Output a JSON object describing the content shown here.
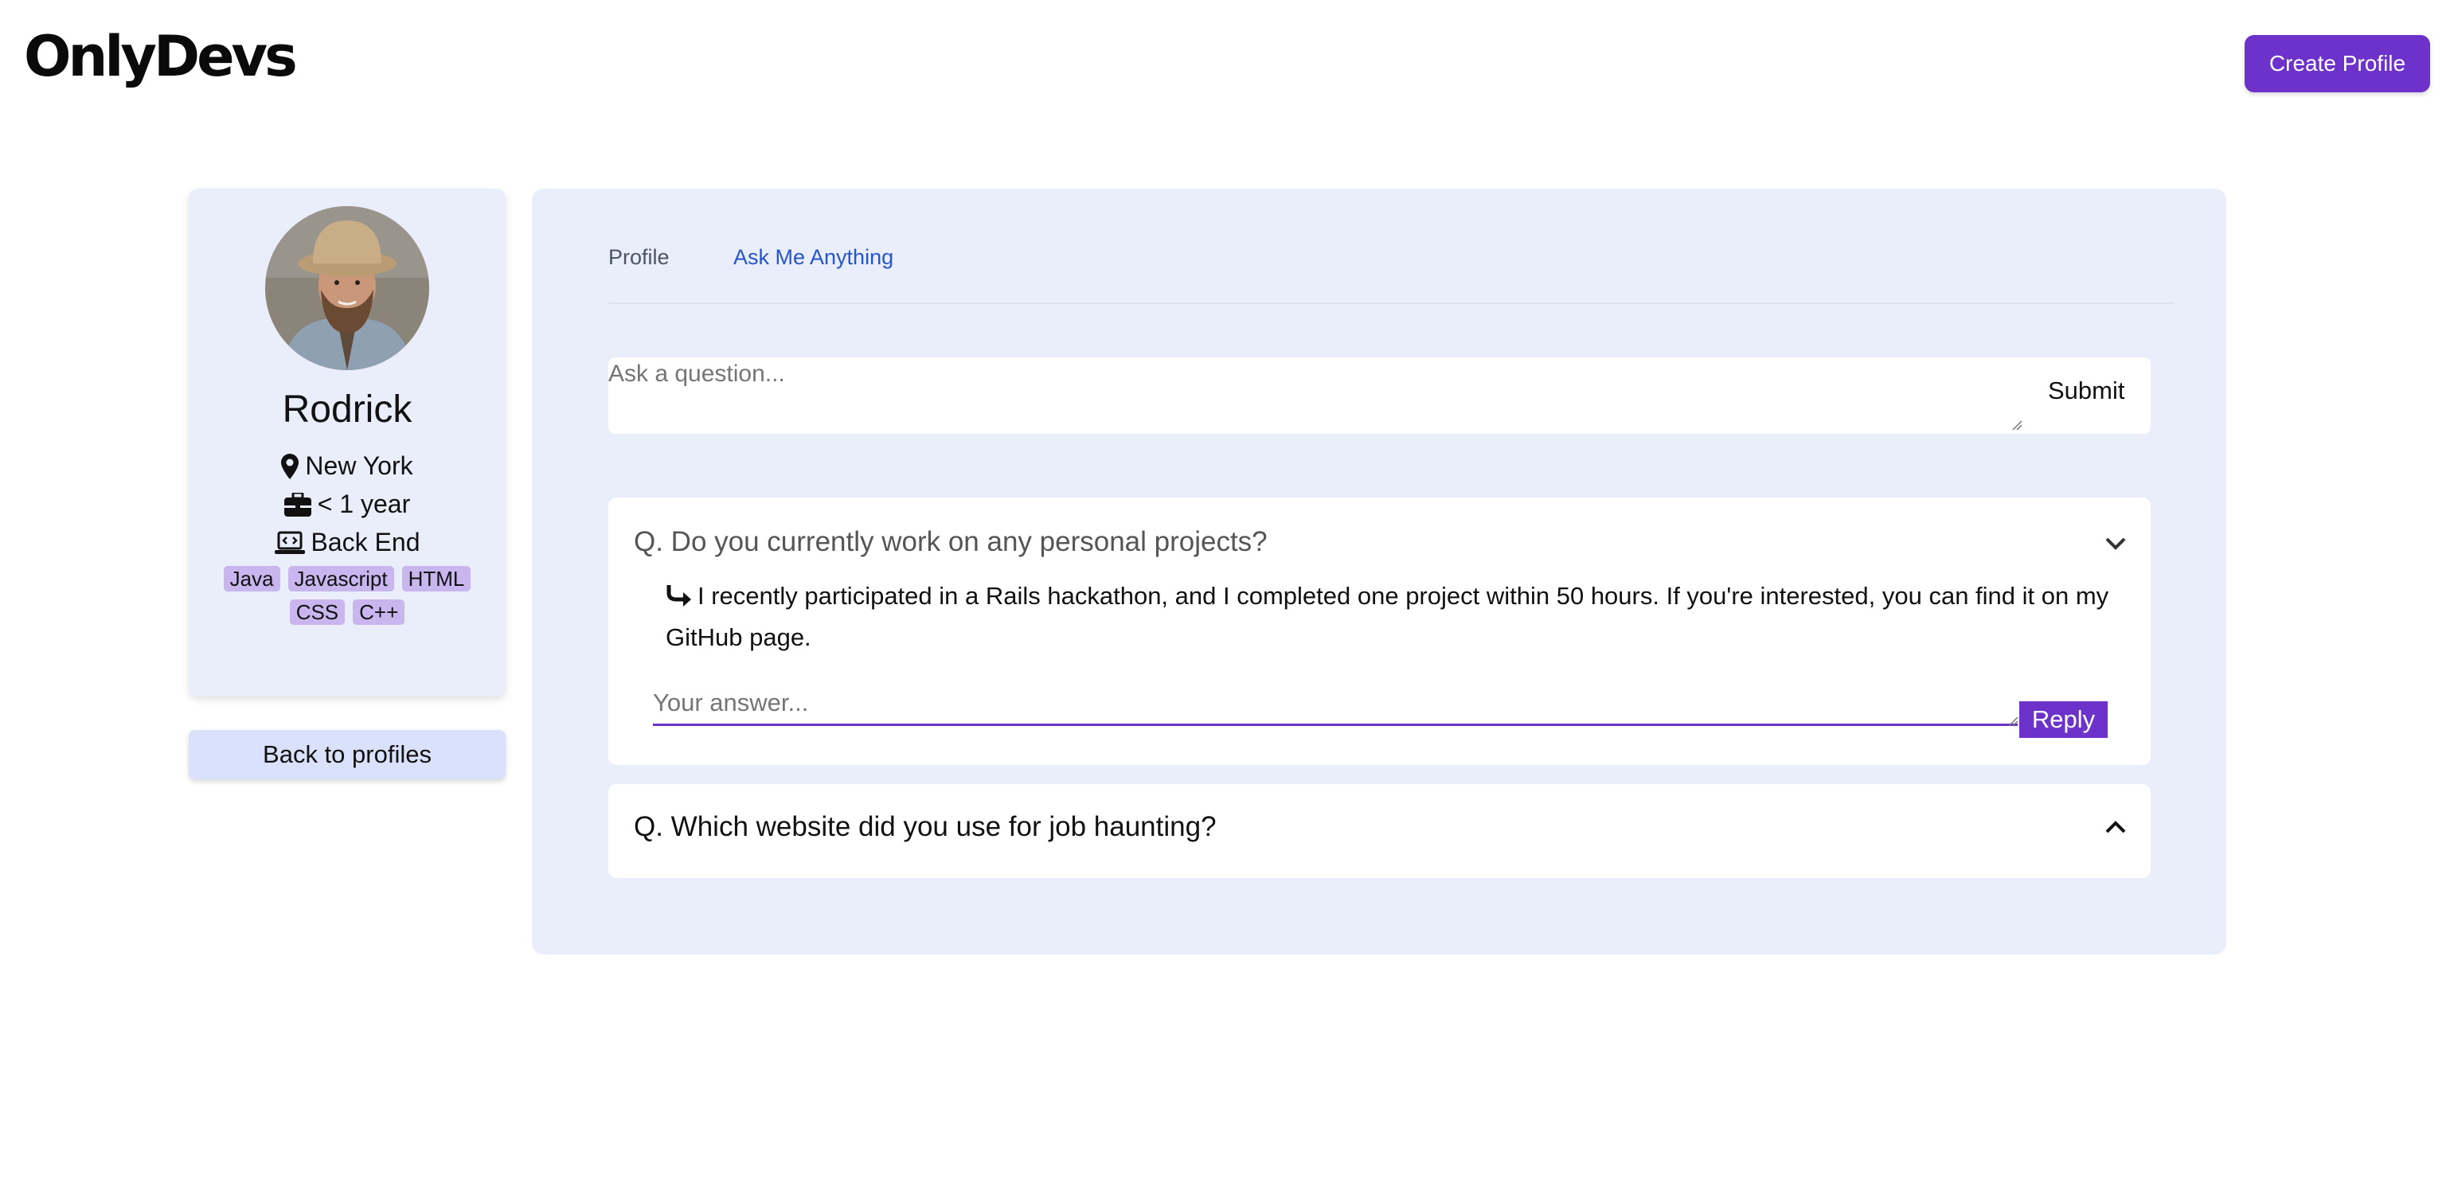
{
  "header": {
    "logo": "OnlyDevs",
    "create_profile_label": "Create Profile"
  },
  "profile": {
    "name": "Rodrick",
    "location": "New York",
    "experience": "< 1 year",
    "role": "Back End",
    "skills": [
      "Java",
      "Javascript",
      "HTML",
      "CSS",
      "C++"
    ]
  },
  "back_label": "Back to profiles",
  "tabs": [
    {
      "label": "Profile",
      "active": false
    },
    {
      "label": "Ask Me Anything",
      "active": true
    }
  ],
  "ask": {
    "placeholder": "Ask a question...",
    "submit_label": "Submit"
  },
  "questions": [
    {
      "question": "Q. Do you currently work on any personal projects?",
      "expanded": true,
      "answer": "I recently participated in a Rails hackathon, and I completed one project within 50 hours. If you're interested, you can find it on my GitHub page.",
      "answer_placeholder": "Your answer...",
      "reply_label": "Reply",
      "icon": "chevron-down-icon"
    },
    {
      "question": "Q. Which website did you use for job haunting?",
      "expanded": false,
      "icon": "chevron-up-icon"
    }
  ],
  "colors": {
    "accent": "#6d32c9",
    "panel": "#eaeefb",
    "tag": "#c9b6ee",
    "active_tab": "#2456c9"
  }
}
